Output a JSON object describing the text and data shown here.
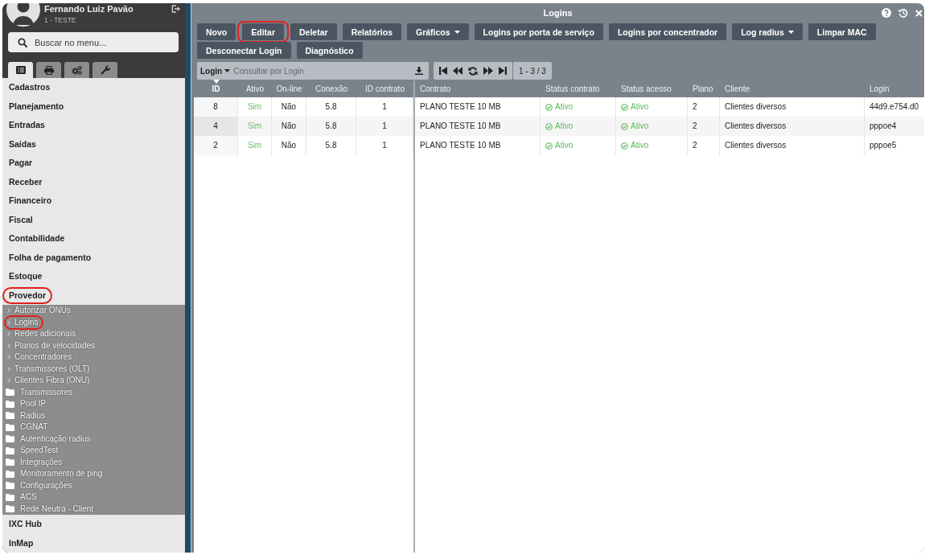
{
  "user": {
    "name": "Fernando Luiz Pavão",
    "company": "1 - TESTE"
  },
  "sidebar": {
    "search": {
      "placeholder": "Buscar no menu..."
    },
    "tabs": [
      {
        "selected": true
      },
      {
        "selected": false
      },
      {
        "selected": false
      },
      {
        "selected": false
      }
    ],
    "menu": [
      {
        "label": "Cadastros",
        "expanded": false,
        "highlighted": false
      },
      {
        "label": "Planejamento",
        "expanded": false,
        "highlighted": false
      },
      {
        "label": "Entradas",
        "expanded": false,
        "highlighted": false
      },
      {
        "label": "Saídas",
        "expanded": false,
        "highlighted": false
      },
      {
        "label": "Pagar",
        "expanded": false,
        "highlighted": false
      },
      {
        "label": "Receber",
        "expanded": false,
        "highlighted": false
      },
      {
        "label": "Financeiro",
        "expanded": false,
        "highlighted": false
      },
      {
        "label": "Fiscal",
        "expanded": false,
        "highlighted": false
      },
      {
        "label": "Contabilidade",
        "expanded": false,
        "highlighted": false
      },
      {
        "label": "Folha de pagamento",
        "expanded": false,
        "highlighted": false
      },
      {
        "label": "Estoque",
        "expanded": false,
        "highlighted": false
      },
      {
        "label": "Provedor",
        "expanded": true,
        "highlighted": true,
        "children": [
          {
            "label": "Autorizar ONUs",
            "kind": "link",
            "highlighted": false
          },
          {
            "label": "Logins",
            "kind": "link",
            "highlighted": true
          },
          {
            "label": "Redes adicionais",
            "kind": "link",
            "highlighted": false
          },
          {
            "label": "Planos de velocidades",
            "kind": "link",
            "highlighted": false
          },
          {
            "label": "Concentradores",
            "kind": "link",
            "highlighted": false
          },
          {
            "label": "Transmissores (OLT)",
            "kind": "link",
            "highlighted": false
          },
          {
            "label": "Clientes Fibra (ONU)",
            "kind": "link",
            "highlighted": false
          },
          {
            "label": "Transmissores",
            "kind": "folder",
            "highlighted": false
          },
          {
            "label": "Pool IP",
            "kind": "folder",
            "highlighted": false
          },
          {
            "label": "Radius",
            "kind": "folder",
            "highlighted": false
          },
          {
            "label": "CGNAT",
            "kind": "folder",
            "highlighted": false
          },
          {
            "label": "Autenticação radius",
            "kind": "folder",
            "highlighted": false
          },
          {
            "label": "SpeedTest",
            "kind": "folder",
            "highlighted": false
          },
          {
            "label": "Integrações",
            "kind": "folder",
            "highlighted": false
          },
          {
            "label": "Monitoramento de ping",
            "kind": "folder",
            "highlighted": false
          },
          {
            "label": "Configurações",
            "kind": "folder",
            "highlighted": false
          },
          {
            "label": "ACS",
            "kind": "folder",
            "highlighted": false
          },
          {
            "label": "Rede Neutra - Client",
            "kind": "folder",
            "highlighted": false
          }
        ]
      },
      {
        "label": "IXC Hub",
        "expanded": false,
        "highlighted": false
      },
      {
        "label": "InMap",
        "expanded": false,
        "highlighted": false
      }
    ]
  },
  "window": {
    "title": "Logins"
  },
  "toolbar": {
    "buttons": [
      {
        "label": "Novo",
        "kind": "action",
        "highlighted": false
      },
      {
        "label": "Editar",
        "kind": "action",
        "highlighted": true
      },
      {
        "label": "Deletar",
        "kind": "action",
        "highlighted": false
      },
      {
        "label": "Relatórios",
        "kind": "action",
        "highlighted": false
      },
      {
        "label": "Gráficos",
        "kind": "menu",
        "highlighted": false
      },
      {
        "label": "Logins por porta de serviço",
        "kind": "action",
        "highlighted": false
      },
      {
        "label": "Logins por concentrador",
        "kind": "action",
        "highlighted": false
      },
      {
        "label": "Log radius",
        "kind": "menu",
        "highlighted": false
      },
      {
        "label": "Limpar MAC",
        "kind": "action",
        "highlighted": false
      },
      {
        "label": "Desconectar Login",
        "kind": "action",
        "highlighted": false
      },
      {
        "label": "Diagnóstico",
        "kind": "action",
        "highlighted": false
      }
    ]
  },
  "filter": {
    "field": "Login",
    "placeholder": "Consultar por Login"
  },
  "pagination": {
    "range": "1 - 3 / 3"
  },
  "table": {
    "frozen_columns": [
      {
        "label": "ID",
        "kind": "number",
        "sorted": true
      },
      {
        "label": "Ativo",
        "kind": "flag",
        "sorted": false
      },
      {
        "label": "On-line",
        "kind": "number",
        "sorted": false
      },
      {
        "label": "Conexão",
        "kind": "number",
        "sorted": false
      },
      {
        "label": "ID contrato",
        "kind": "number",
        "sorted": false
      }
    ],
    "columns": [
      {
        "label": "Contrato",
        "kind": "text",
        "sorted": false
      },
      {
        "label": "Status contrato",
        "kind": "status",
        "sorted": false
      },
      {
        "label": "Status acesso",
        "kind": "status",
        "sorted": false
      },
      {
        "label": "Plano",
        "kind": "text",
        "sorted": false
      },
      {
        "label": "Cliente",
        "kind": "text",
        "sorted": false
      },
      {
        "label": "Login",
        "kind": "text",
        "sorted": false
      }
    ],
    "rows": [
      {
        "frozen_cells": [
          "8",
          "Sim",
          "Não",
          "5.8",
          "1"
        ],
        "cells": [
          "PLANO TESTE 10 MB",
          "Ativo",
          "Ativo",
          "2",
          "Clientes diversos",
          "44d9.e754.d0"
        ]
      },
      {
        "frozen_cells": [
          "4",
          "Sim",
          "Não",
          "5.8",
          "1"
        ],
        "cells": [
          "PLANO TESTE 10 MB",
          "Ativo",
          "Ativo",
          "2",
          "Clientes diversos",
          "pppoe4"
        ]
      },
      {
        "frozen_cells": [
          "2",
          "Sim",
          "Não",
          "5.8",
          "1"
        ],
        "cells": [
          "PLANO TESTE 10 MB",
          "Ativo",
          "Ativo",
          "2",
          "Clientes diversos",
          "pppoe5"
        ]
      }
    ]
  }
}
